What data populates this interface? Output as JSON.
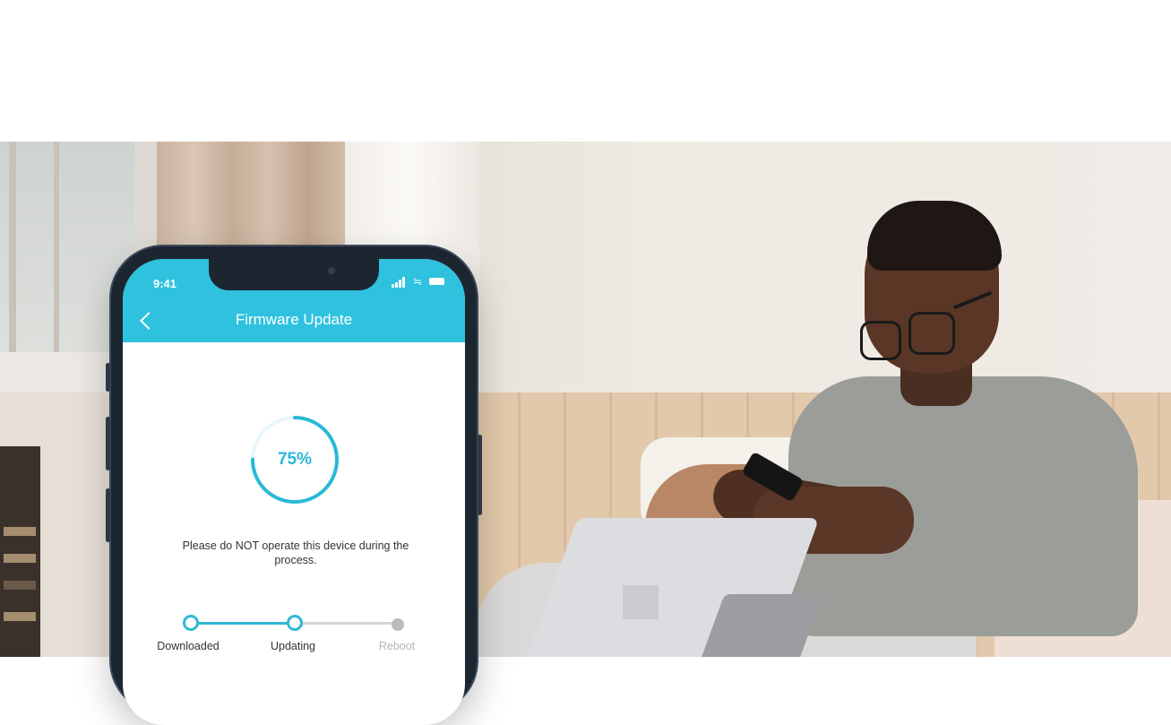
{
  "phone": {
    "status_time": "9:41",
    "header": {
      "title": "Firmware Update",
      "color": "#2fc2df"
    },
    "progress": {
      "percent": 75,
      "label": "75%",
      "color": "#29b9d6"
    },
    "warning_text": "Please do NOT operate this device during the process.",
    "steps": [
      {
        "label": "Downloaded",
        "state": "complete"
      },
      {
        "label": "Updating",
        "state": "active"
      },
      {
        "label": "Reboot",
        "state": "pending"
      }
    ],
    "icons": [
      "back-icon",
      "signal-icon",
      "wifi-icon",
      "battery-icon"
    ]
  },
  "colors": {
    "accent": "#2fc2df",
    "step_done": "#2fb8d4",
    "step_pending": "#b9bcbf"
  }
}
